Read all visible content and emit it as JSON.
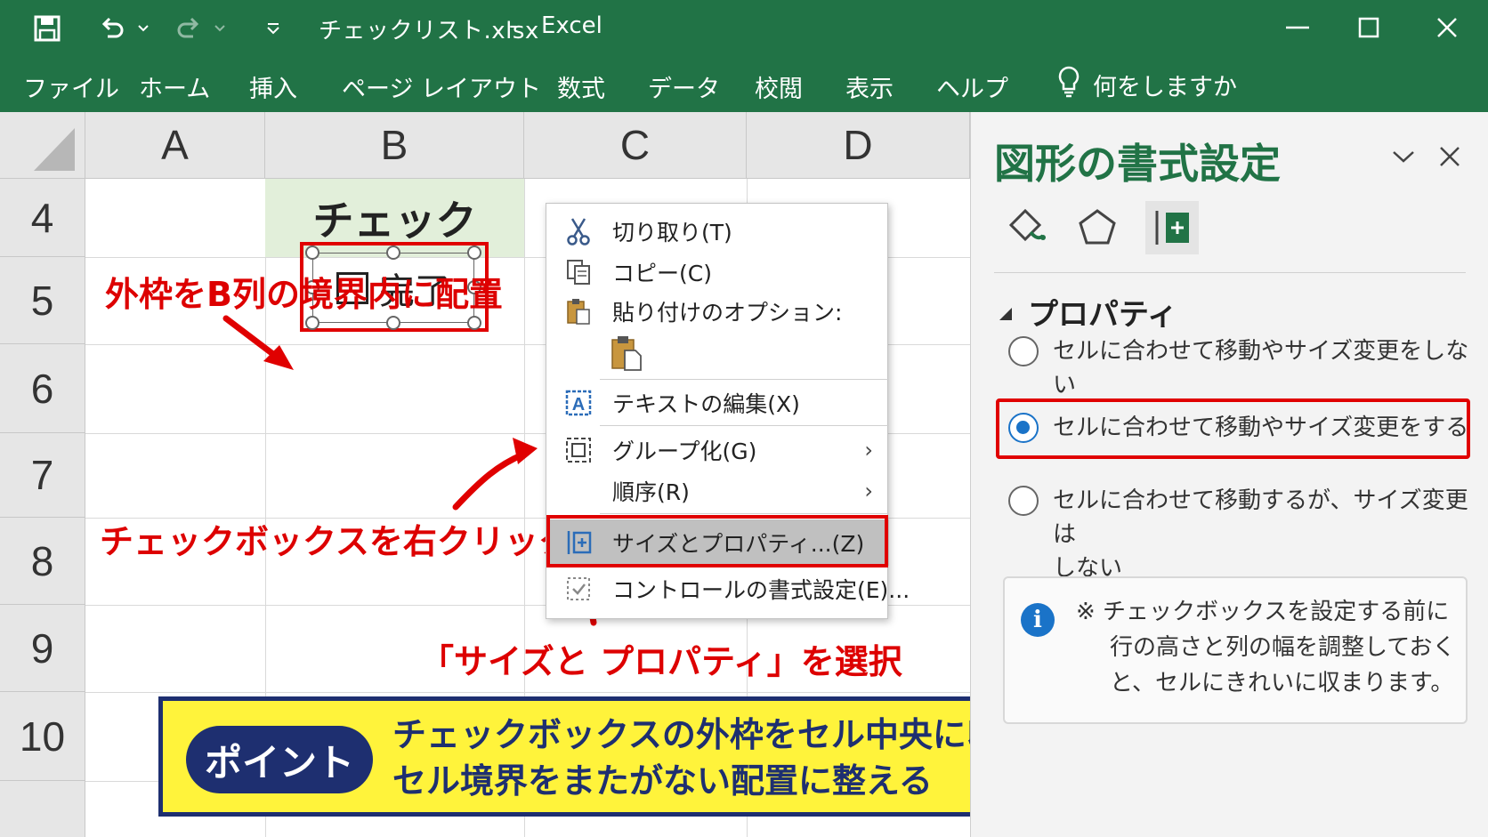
{
  "window": {
    "title": "チェックリスト.xlsx",
    "separator": "-",
    "app": "Excel"
  },
  "ribbon": {
    "tabs": [
      "ファイル",
      "ホーム",
      "挿入",
      "ページ レイアウト",
      "数式",
      "データ",
      "校閲",
      "表示",
      "ヘルプ"
    ],
    "tell_me": "何をしますか"
  },
  "sheet": {
    "columns": [
      "A",
      "B",
      "C",
      "D"
    ],
    "rows": [
      "4",
      "5",
      "6",
      "7",
      "8",
      "9",
      "10"
    ],
    "b4_text": "チェック",
    "checkbox_label": "完了"
  },
  "annotations": {
    "border_note": "外枠をB列の境界内に配置",
    "right_click_note": "チェックボックスを右クリック",
    "select_note": "「サイズと プロパティ」を選択"
  },
  "context_menu": {
    "cut": "切り取り(T)",
    "copy": "コピー(C)",
    "paste_options": "貼り付けのオプション:",
    "edit_text": "テキストの編集(X)",
    "group": "グループ化(G)",
    "order": "順序(R)",
    "size_props": "サイズとプロパティ...(Z)",
    "format_control": "コントロールの書式設定(E)..."
  },
  "point": {
    "badge": "ポイント",
    "line1": "チェックボックスの外枠をセル中央に収める",
    "line2": "セル境界をまたがない配置に整える"
  },
  "pane": {
    "title": "図形の書式設定",
    "section": "プロパティ",
    "options": [
      {
        "label": "セルに合わせて移動やサイズ変更をしない",
        "selected": false
      },
      {
        "label": "セルに合わせて移動やサイズ変更をする",
        "selected": true
      },
      {
        "label_line1": "セルに合わせて移動するが、サイズ変更は",
        "label_line2": "しない",
        "selected": false
      }
    ],
    "info": {
      "line1": "※ チェックボックスを設定する前に",
      "line2": "行の高さと列の幅を調整しておく",
      "line3": "と、セルにきれいに収まります。"
    }
  },
  "colors": {
    "excel_green": "#217346",
    "annotation_red": "#e00000",
    "point_yellow": "#fff33b",
    "point_navy": "#1e2f70",
    "b4_fill": "#e2efda",
    "radio_blue": "#1a73c8"
  }
}
